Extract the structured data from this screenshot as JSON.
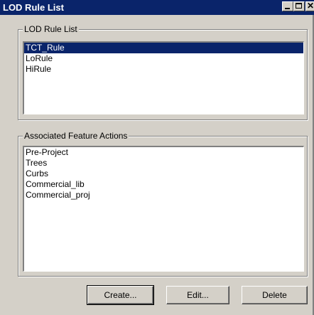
{
  "window": {
    "title": "LOD Rule List"
  },
  "rule_group": {
    "legend": "LOD Rule List",
    "items": [
      {
        "label": "TCT_Rule",
        "selected": true
      },
      {
        "label": "LoRule",
        "selected": false
      },
      {
        "label": "HiRule",
        "selected": false
      }
    ]
  },
  "actions_group": {
    "legend": "Associated Feature Actions",
    "items": [
      {
        "label": "Pre-Project"
      },
      {
        "label": "Trees"
      },
      {
        "label": "Curbs"
      },
      {
        "label": "Commercial_lib"
      },
      {
        "label": "Commercial_proj"
      }
    ]
  },
  "buttons": {
    "create": "Create...",
    "edit": "Edit...",
    "delete": "Delete"
  },
  "icons": {
    "minimize": "minimize-icon",
    "maximize": "maximize-icon",
    "close": "close-icon"
  },
  "colors": {
    "titlebar": "#0a246a",
    "selection": "#0a246a",
    "face": "#d4d0c8"
  }
}
